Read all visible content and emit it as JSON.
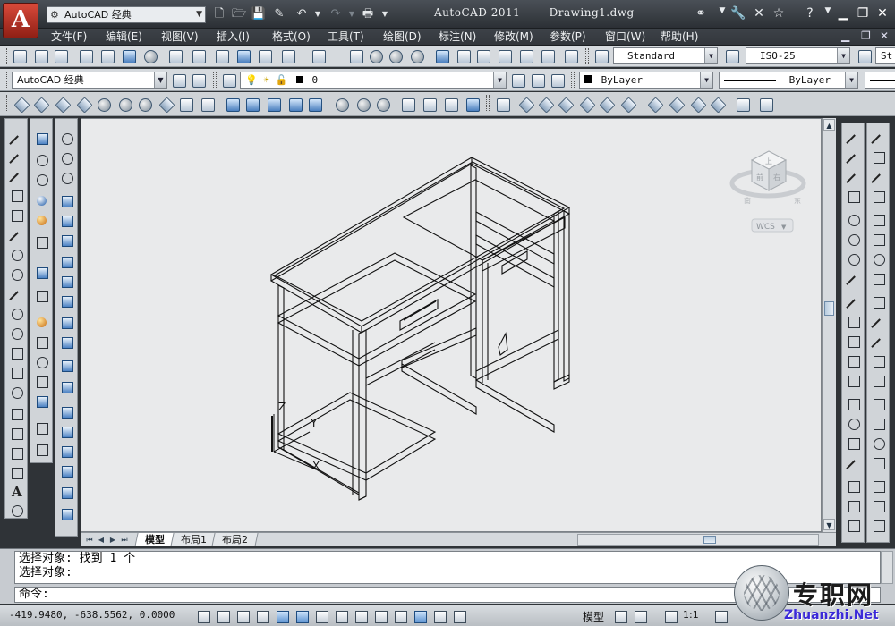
{
  "app": {
    "logo_letter": "A",
    "workspace": "AutoCAD 经典",
    "product": "AutoCAD 2011",
    "document": "Drawing1.dwg"
  },
  "menu": {
    "items": [
      "文件(F)",
      "编辑(E)",
      "视图(V)",
      "插入(I)",
      "格式(O)",
      "工具(T)",
      "绘图(D)",
      "标注(N)",
      "修改(M)",
      "参数(P)",
      "窗口(W)",
      "帮助(H)"
    ]
  },
  "toolbar": {
    "text_style": "Standard",
    "dim_style": "ISO-25",
    "table_style_partial": "St",
    "workspace_combo": "AutoCAD 经典",
    "layer_name": "0",
    "color": "ByLayer",
    "linetype": "ByLayer"
  },
  "viewcube": {
    "top": "上",
    "front": "前",
    "right": "右",
    "south": "南",
    "east": "东",
    "wcs": "WCS"
  },
  "ucs": {
    "z": "Z",
    "y": "Y",
    "x": "X"
  },
  "layout_tabs": [
    "模型",
    "布局1",
    "布局2"
  ],
  "command": {
    "history": [
      "选择对象: 找到 1 个",
      "选择对象:"
    ],
    "prompt": "命令:"
  },
  "status": {
    "coords": "-419.9480, -638.5562, 0.0000",
    "model": "模型",
    "annotation_scale": "1:1"
  },
  "watermark": {
    "cn": "专职网",
    "en": "Zhuanzhi.Net"
  }
}
